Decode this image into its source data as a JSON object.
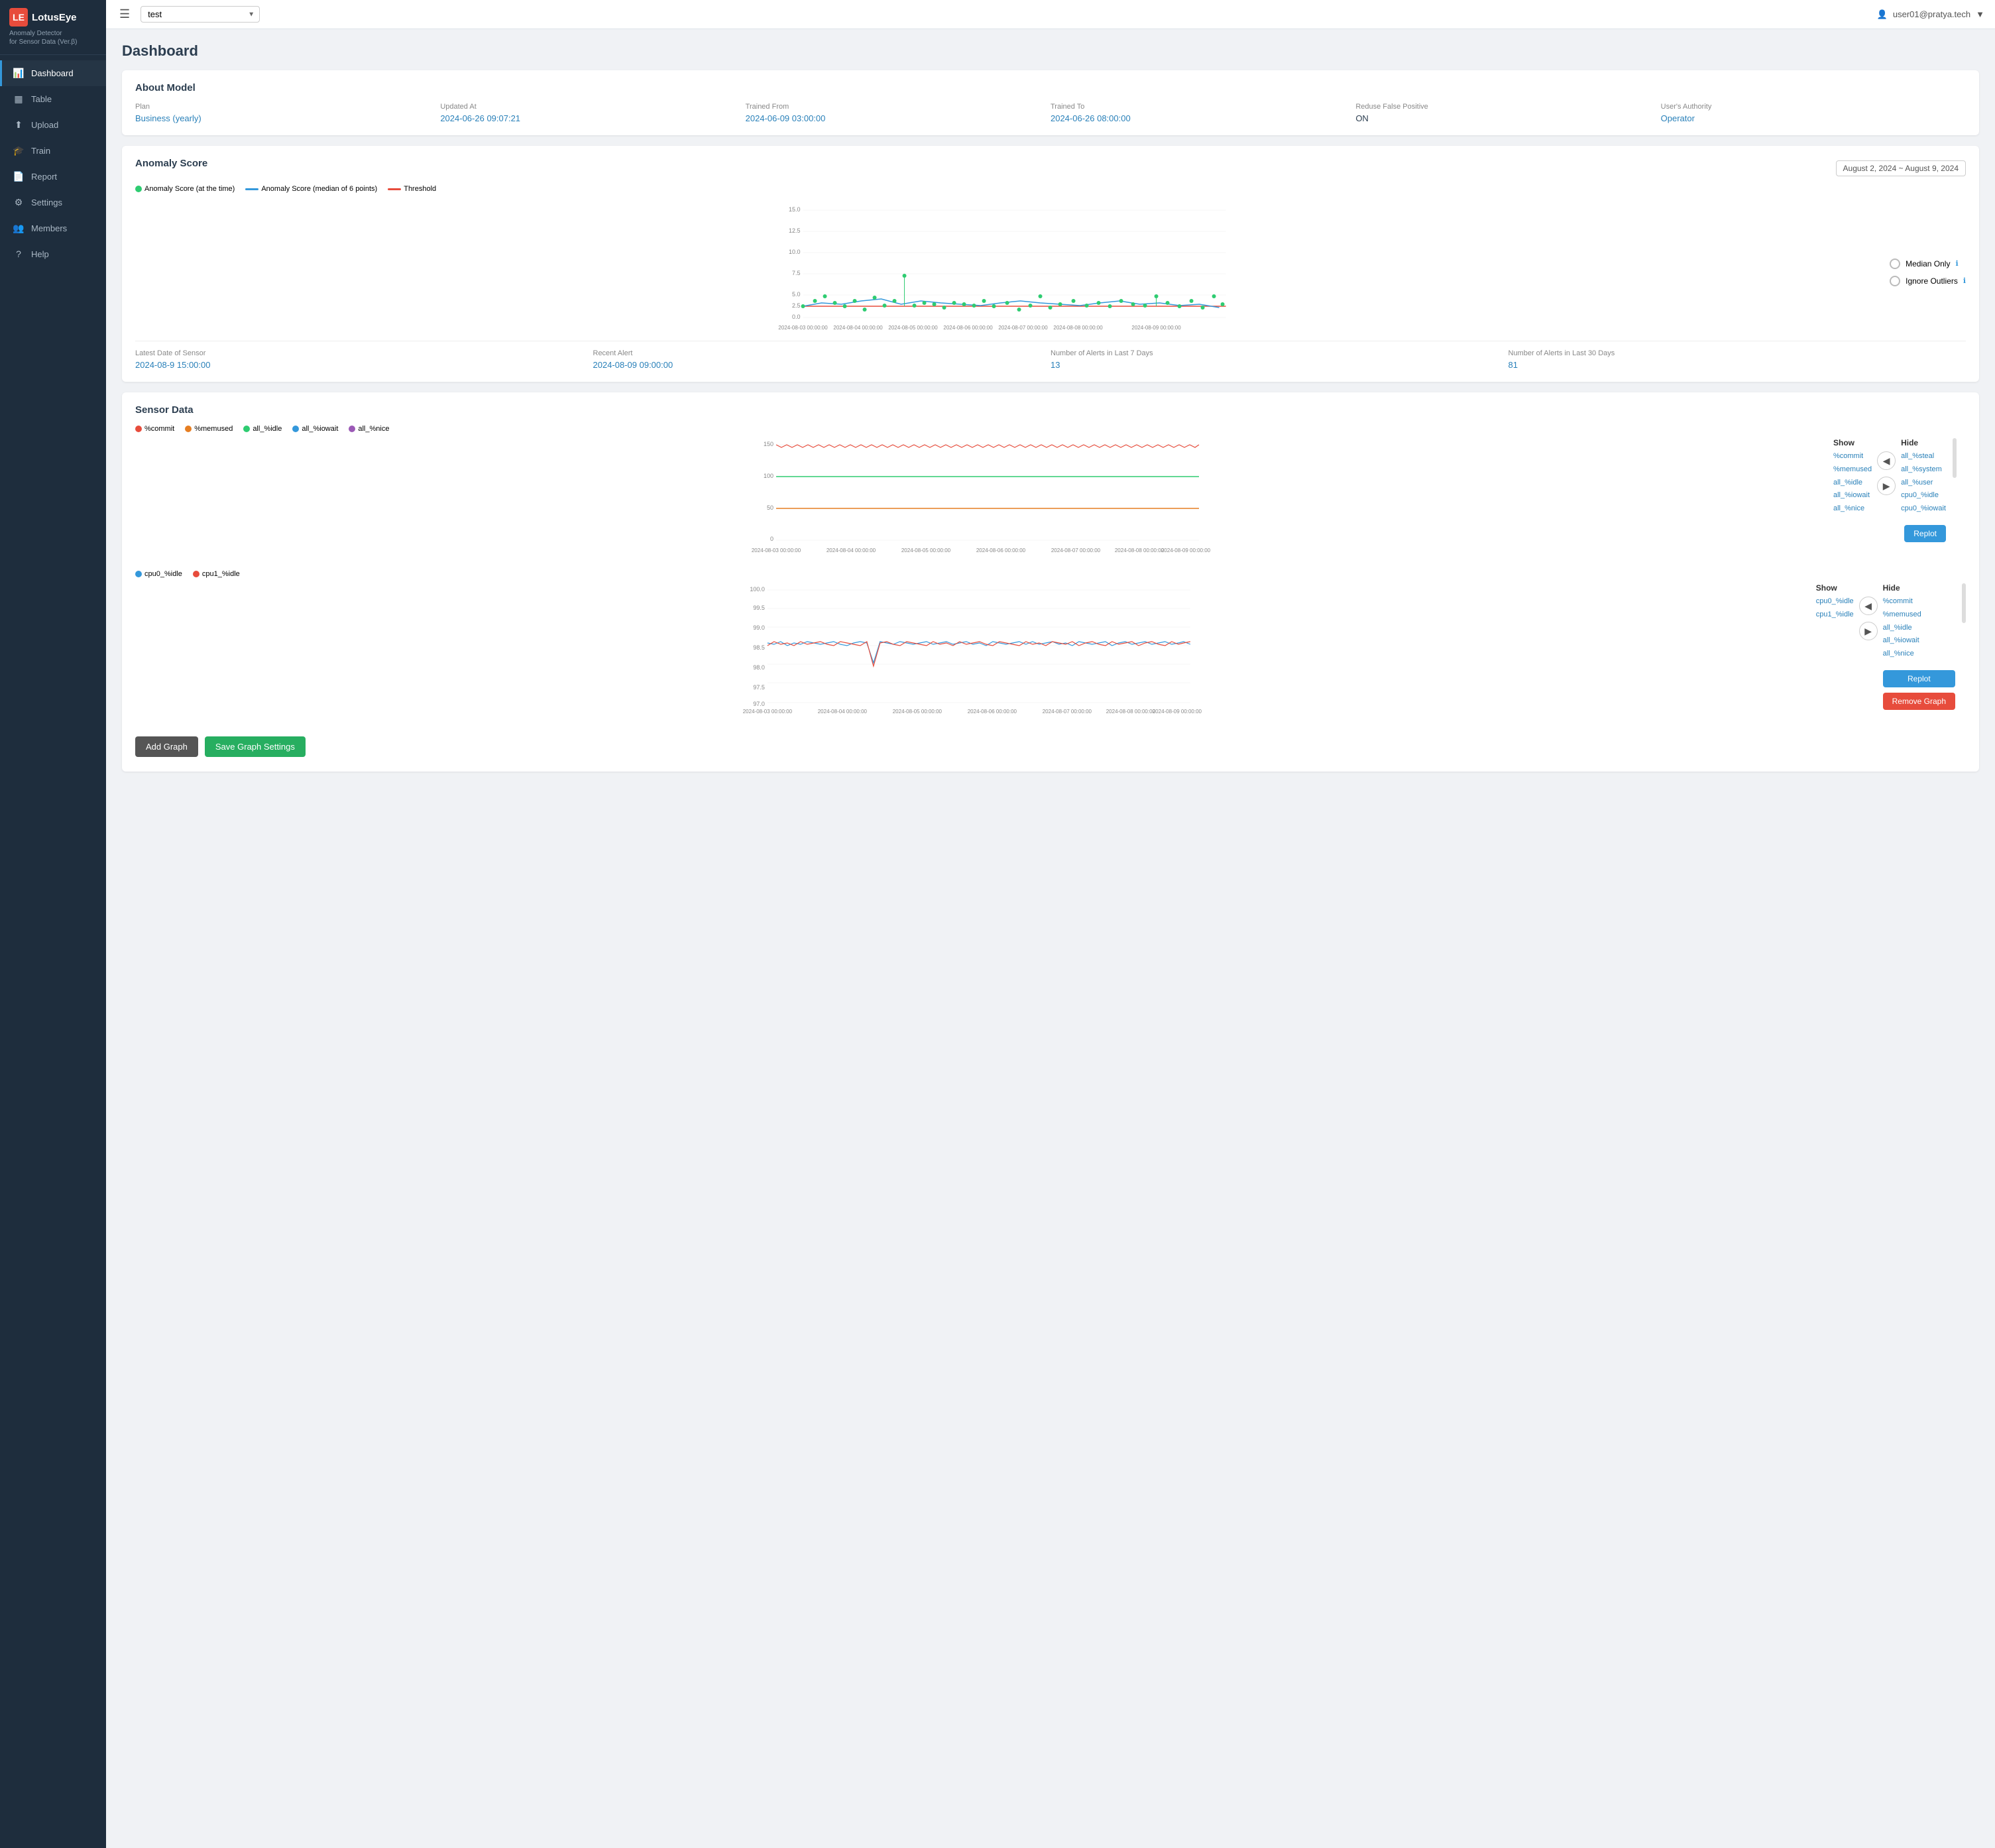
{
  "app": {
    "logo_text": "LotusEye",
    "subtitle": "Anomaly Detector\nfor Sensor Data (Ver.β)"
  },
  "sidebar": {
    "items": [
      {
        "id": "dashboard",
        "label": "Dashboard",
        "icon": "📊",
        "active": true
      },
      {
        "id": "table",
        "label": "Table",
        "icon": "📋",
        "active": false
      },
      {
        "id": "upload",
        "label": "Upload",
        "icon": "⬆",
        "active": false
      },
      {
        "id": "train",
        "label": "Train",
        "icon": "🎓",
        "active": false
      },
      {
        "id": "report",
        "label": "Report",
        "icon": "📄",
        "active": false
      },
      {
        "id": "settings",
        "label": "Settings",
        "icon": "⚙",
        "active": false
      },
      {
        "id": "members",
        "label": "Members",
        "icon": "👥",
        "active": false
      },
      {
        "id": "help",
        "label": "Help",
        "icon": "?",
        "active": false
      }
    ]
  },
  "topbar": {
    "model_select_value": "test",
    "user_label": "user01@pratya.tech"
  },
  "page_title": "Dashboard",
  "about_model": {
    "title": "About Model",
    "fields": [
      {
        "label": "Plan",
        "value": "Business (yearly)",
        "colored": true
      },
      {
        "label": "Updated At",
        "value": "2024-06-26 09:07:21",
        "colored": true
      },
      {
        "label": "Trained From",
        "value": "2024-06-09 03:00:00",
        "colored": true
      },
      {
        "label": "Trained To",
        "value": "2024-06-26 08:00:00",
        "colored": true
      },
      {
        "label": "Reduse False Positive",
        "value": "ON",
        "colored": false
      },
      {
        "label": "User's Authority",
        "value": "Operator",
        "colored": true
      }
    ]
  },
  "anomaly_score": {
    "title": "Anomaly Score",
    "date_range": "August 2, 2024 ~ August 9, 2024",
    "legend": [
      {
        "label": "Anomaly Score (at the time)",
        "color": "#2ecc71",
        "type": "dot"
      },
      {
        "label": "Anomaly Score (median of 6 points)",
        "color": "#3498db",
        "type": "line"
      },
      {
        "label": "Threshold",
        "color": "#e74c3c",
        "type": "line"
      }
    ],
    "options": [
      {
        "label": "Median Only",
        "checked": false
      },
      {
        "label": "Ignore Outliers",
        "checked": false
      }
    ],
    "stats": [
      {
        "label": "Latest Date of Sensor",
        "value": "2024-08-9 15:00:00"
      },
      {
        "label": "Recent Alert",
        "value": "2024-08-09 09:00:00"
      },
      {
        "label": "Number of Alerts in Last 7 Days",
        "value": "13"
      },
      {
        "label": "Number of Alerts in Last 30 Days",
        "value": "81"
      }
    ]
  },
  "sensor_data": {
    "title": "Sensor Data",
    "chart1": {
      "legend": [
        {
          "label": "%commit",
          "color": "#e74c3c"
        },
        {
          "label": "%memused",
          "color": "#e67e22"
        },
        {
          "label": "all_%idle",
          "color": "#2ecc71"
        },
        {
          "label": "all_%iowait",
          "color": "#3498db"
        },
        {
          "label": "all_%nice",
          "color": "#9b59b6"
        }
      ],
      "show_items": [
        "%commit",
        "%memused",
        "all_%idle",
        "all_%iowait",
        "all_%nice"
      ],
      "hide_items": [
        "all_%steal",
        "all_%system",
        "all_%user",
        "cpu0_%idle",
        "cpu0_%iowait"
      ]
    },
    "chart2": {
      "legend": [
        {
          "label": "cpu0_%idle",
          "color": "#3498db"
        },
        {
          "label": "cpu1_%idle",
          "color": "#e74c3c"
        }
      ],
      "show_items": [
        "cpu0_%idle",
        "cpu1_%idle"
      ],
      "hide_items": [
        "%commit",
        "%memused",
        "all_%idle",
        "all_%iowait",
        "all_%nice"
      ]
    }
  },
  "buttons": {
    "add_graph": "Add Graph",
    "save_graph_settings": "Save Graph Settings",
    "replot": "Replot",
    "remove_graph": "Remove Graph"
  }
}
